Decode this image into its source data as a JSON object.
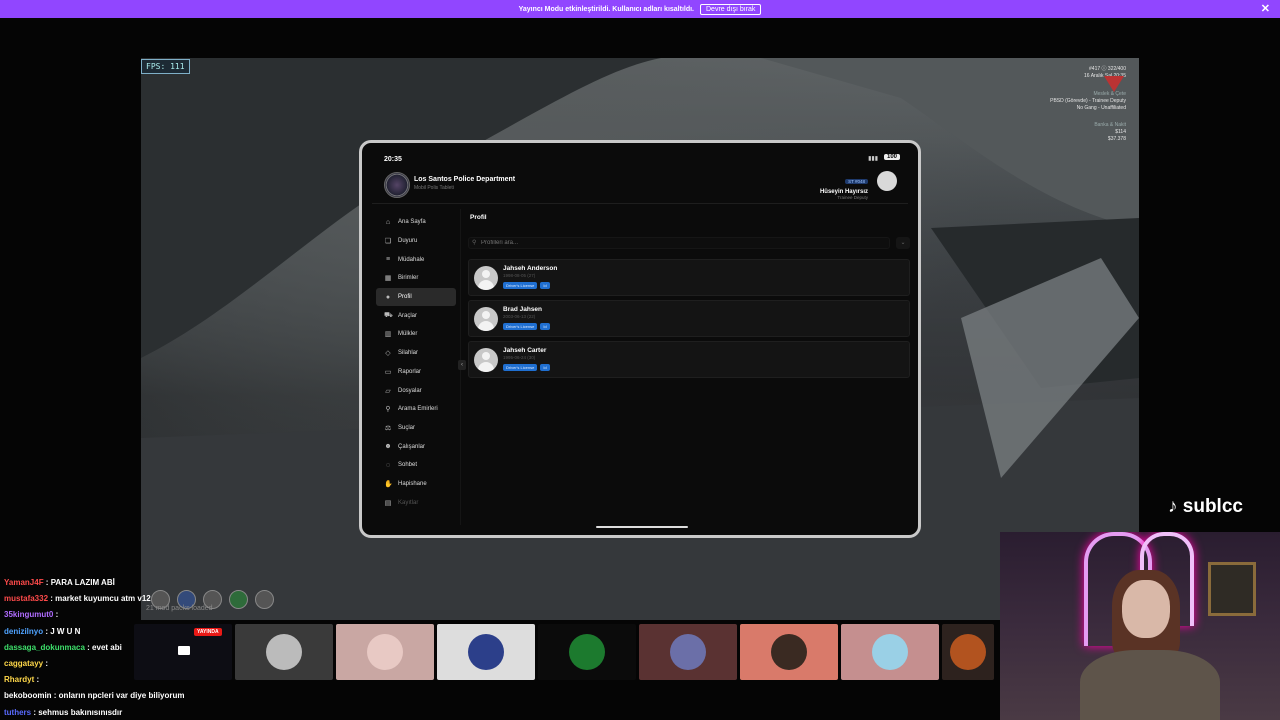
{
  "banner": {
    "message": "Yayıncı Modu etkinleştirildi. Kullanıcı adları kısaltıldı.",
    "disable_label": "Devre dışı bırak",
    "close_icon": "close-icon"
  },
  "game": {
    "fps_label": "FPS: 111",
    "hud": {
      "line1": "#417 ⓘ 322/400",
      "line2": "16 Aralık Sal 20:35",
      "section_job": "Meslek & Çete",
      "job": "PBSD (Görevde) - Trainee Deputy",
      "gang": "No Gang - Unaffiliated",
      "section_money": "Banka & Nakit",
      "bank": "$114",
      "cash": "$37.378"
    },
    "mod_text": "21 mod packs loaded"
  },
  "tablet": {
    "time": "20:35",
    "battery": "100",
    "department": "Los Santos Police Department",
    "subtitle": "Mobil Polis Tableti",
    "user_badge": "ST #048",
    "user_name": "Hüseyin Hayırsız",
    "user_rank": "Trainee Deputy",
    "nav": [
      {
        "label": "Ana Sayfa",
        "icon": "home-icon",
        "glyph": "⌂"
      },
      {
        "label": "Duyuru",
        "icon": "bookmark-icon",
        "glyph": "❏"
      },
      {
        "label": "Müdahale",
        "icon": "intervention-icon",
        "glyph": "≡"
      },
      {
        "label": "Birimler",
        "icon": "grid-icon",
        "glyph": "▦"
      },
      {
        "label": "Profil",
        "icon": "user-icon",
        "glyph": "●"
      },
      {
        "label": "Araçlar",
        "icon": "car-icon",
        "glyph": "⛟"
      },
      {
        "label": "Mülkler",
        "icon": "building-icon",
        "glyph": "▥"
      },
      {
        "label": "Silahlar",
        "icon": "weapon-icon",
        "glyph": "◇"
      },
      {
        "label": "Raporlar",
        "icon": "report-icon",
        "glyph": "▭"
      },
      {
        "label": "Dosyalar",
        "icon": "folder-icon",
        "glyph": "▱"
      },
      {
        "label": "Arama Emirleri",
        "icon": "warrant-icon",
        "glyph": "⚲"
      },
      {
        "label": "Suçlar",
        "icon": "crime-icon",
        "glyph": "⚖"
      },
      {
        "label": "Çalışanlar",
        "icon": "employees-icon",
        "glyph": "☻"
      },
      {
        "label": "Sohbet",
        "icon": "chat-icon",
        "glyph": "◌"
      },
      {
        "label": "Hapishane",
        "icon": "prison-icon",
        "glyph": "✋"
      },
      {
        "label": "Kayıtlar",
        "icon": "records-icon",
        "glyph": "▤"
      }
    ],
    "page_title": "Profil",
    "search_placeholder": "Profilleri ara...",
    "profiles": [
      {
        "name": "Jahseh Anderson",
        "dob": "1998-08-05 (27)",
        "tags": [
          "Driver's License",
          "Id"
        ]
      },
      {
        "name": "Brad Jahsen",
        "dob": "2003-06-13 (22)",
        "tags": [
          "Driver's License",
          "Id"
        ]
      },
      {
        "name": "Jahseh Carter",
        "dob": "1995-06-24 (30)",
        "tags": [
          "Driver's License",
          "Id"
        ]
      }
    ]
  },
  "stream": {
    "live_label": "YAYINDA",
    "brand": "sublcc"
  },
  "chat": [
    {
      "user": "YamanJ4F",
      "color": "#ff4b4b",
      "msg": "PARA LAZIM ABİ"
    },
    {
      "user": "mustafa332",
      "color": "#ff4b4b",
      "msg": "market kuyumcu atm v12"
    },
    {
      "user": "35kingumut0",
      "color": "#b06cff",
      "msg": ""
    },
    {
      "user": "denizilnyo",
      "color": "#4fa3ff",
      "msg": "J W U N"
    },
    {
      "user": "dassaga_dokunmaca",
      "color": "#3ee06b",
      "msg": "evet abi"
    },
    {
      "user": "caggatayy",
      "color": "#ffd84a",
      "msg": ""
    },
    {
      "user": "Rhardyt",
      "color": "#ffd84a",
      "msg": ""
    },
    {
      "user": "bekoboomin",
      "color": "#ffffff",
      "msg": "onların npcleri var diye biliyorum"
    },
    {
      "user": "tuthers",
      "color": "#5a6bff",
      "msg": "sehmus bakınısınısdır"
    }
  ]
}
